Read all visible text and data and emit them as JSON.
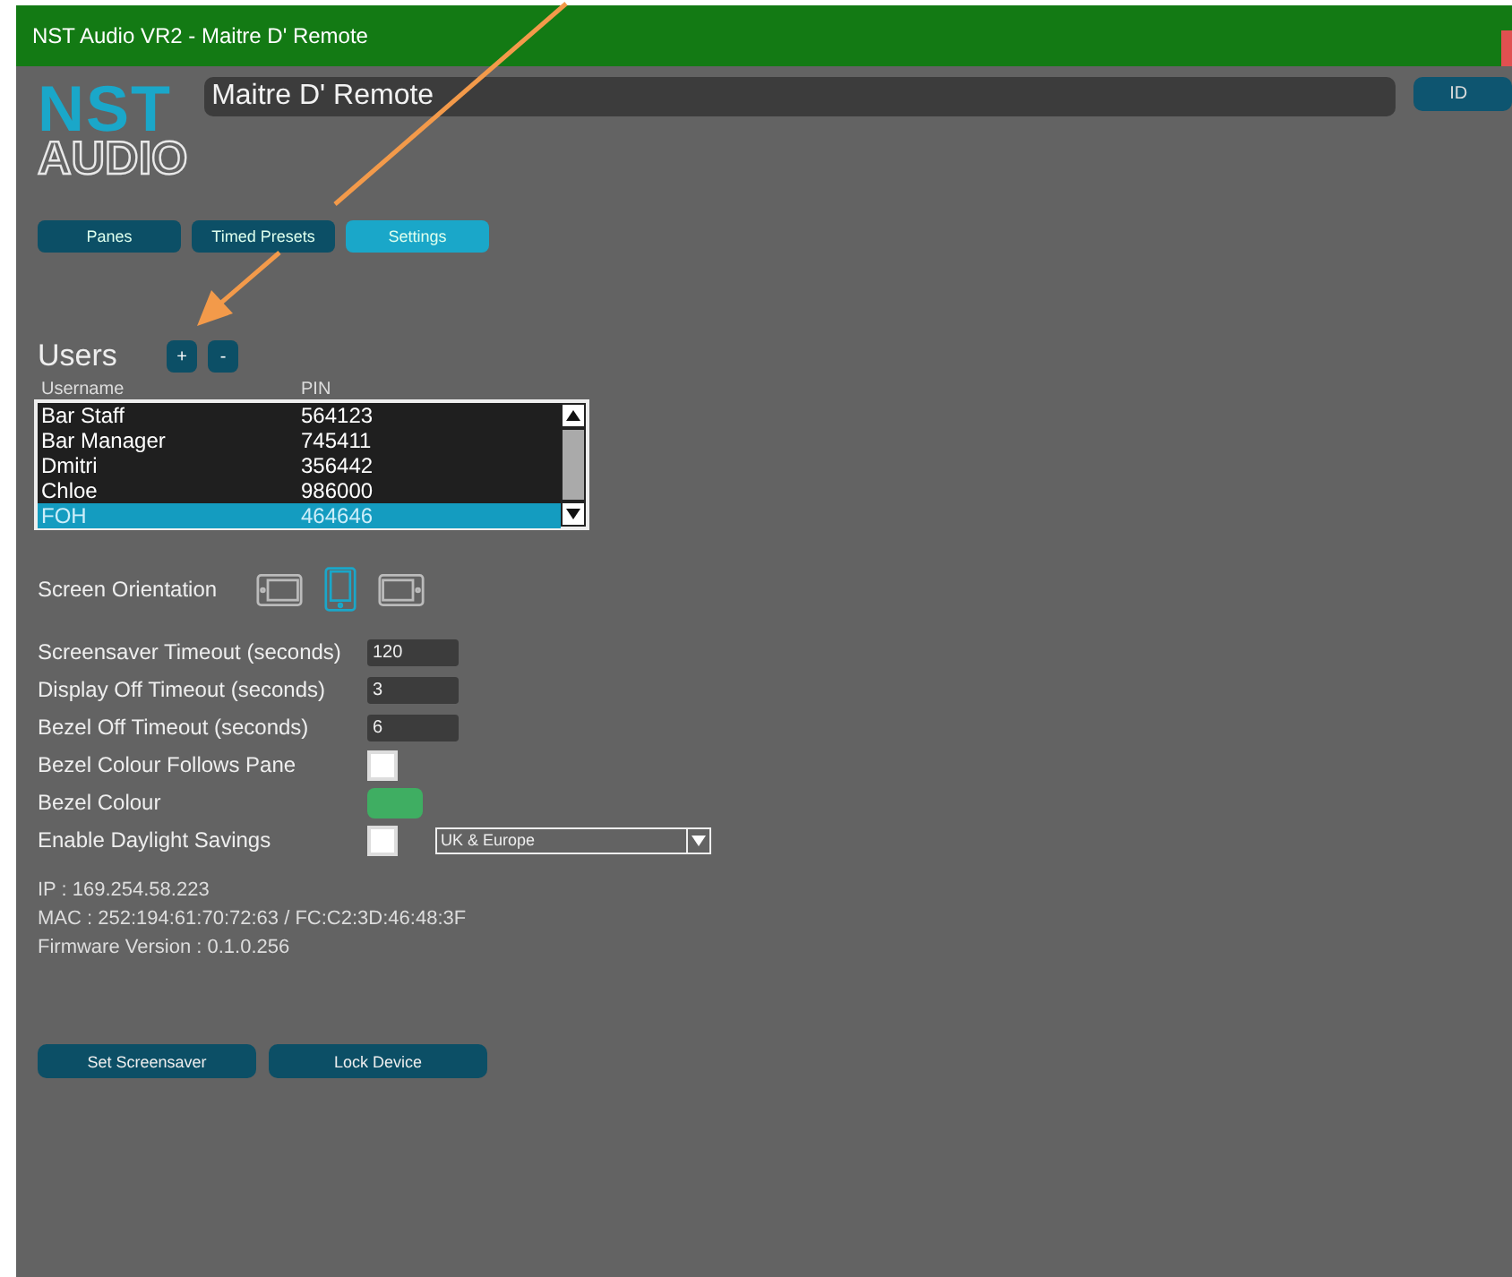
{
  "window": {
    "title": "NST Audio VR2 - Maitre D' Remote"
  },
  "logo": {
    "top": "NST",
    "bottom": "AUDIO"
  },
  "device_name": {
    "value": "Maitre D' Remote"
  },
  "id_button": "ID",
  "tabs": [
    {
      "label": "Panes",
      "selected": false
    },
    {
      "label": "Timed Presets",
      "selected": false
    },
    {
      "label": "Settings",
      "selected": true
    }
  ],
  "users": {
    "title": "Users",
    "add": "+",
    "remove": "-",
    "columns": [
      "Username",
      "PIN"
    ],
    "rows": [
      {
        "username": "Bar Staff",
        "pin": "564123",
        "selected": false
      },
      {
        "username": "Bar Manager",
        "pin": "745411",
        "selected": false
      },
      {
        "username": "Dmitri",
        "pin": "356442",
        "selected": false
      },
      {
        "username": "Chloe",
        "pin": "986000",
        "selected": false
      },
      {
        "username": "FOH",
        "pin": "464646",
        "selected": true
      }
    ]
  },
  "orientation": {
    "label": "Screen Orientation",
    "options": [
      {
        "kind": "landscape-left",
        "selected": false
      },
      {
        "kind": "portrait",
        "selected": true
      },
      {
        "kind": "landscape-right",
        "selected": false
      }
    ]
  },
  "settings": [
    {
      "kind": "field",
      "label": "Screensaver Timeout (seconds)",
      "value": "120"
    },
    {
      "kind": "field",
      "label": "Display Off Timeout (seconds)",
      "value": "3"
    },
    {
      "kind": "field",
      "label": "Bezel Off Timeout (seconds)",
      "value": "6"
    },
    {
      "kind": "checkbox",
      "label": "Bezel Colour Follows Pane",
      "checked": false
    },
    {
      "kind": "color",
      "label": "Bezel Colour",
      "color": "#3fae62"
    },
    {
      "kind": "checkbox-dropdown",
      "label": "Enable Daylight Savings",
      "checked": false,
      "value": "UK & Europe"
    }
  ],
  "info": [
    "IP : 169.254.58.223",
    "MAC : 252:194:61:70:72:63 / FC:C2:3D:46:48:3F",
    "Firmware Version : 0.1.0.256"
  ],
  "buttons": [
    "Set Screensaver",
    "Lock Device"
  ]
}
